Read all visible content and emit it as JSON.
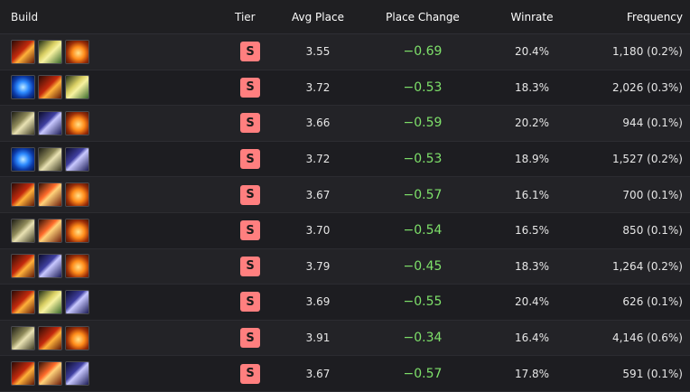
{
  "header": {
    "build": "Build",
    "tier": "Tier",
    "avg_place": "Avg Place",
    "place_change": "Place Change",
    "winrate": "Winrate",
    "frequency": "Frequency"
  },
  "rows": [
    {
      "items": [
        "blade-icon",
        "bolt-icon",
        "fire-orb-icon"
      ],
      "tier": "S",
      "avg_place": "3.55",
      "place_change": "−0.69",
      "winrate": "20.4%",
      "frequency": "1,180 (0.2%)"
    },
    {
      "items": [
        "water-orb-icon",
        "blade-icon",
        "bolt-icon"
      ],
      "tier": "S",
      "avg_place": "3.72",
      "place_change": "−0.53",
      "winrate": "18.3%",
      "frequency": "2,026 (0.3%)"
    },
    {
      "items": [
        "axe-icon",
        "spear-icon",
        "fire-orb-icon"
      ],
      "tier": "S",
      "avg_place": "3.66",
      "place_change": "−0.59",
      "winrate": "20.2%",
      "frequency": "944 (0.1%)"
    },
    {
      "items": [
        "water-orb-icon",
        "axe-icon",
        "spear-icon"
      ],
      "tier": "S",
      "avg_place": "3.72",
      "place_change": "−0.53",
      "winrate": "18.9%",
      "frequency": "1,527 (0.2%)"
    },
    {
      "items": [
        "blade-icon",
        "arrow-icon",
        "fire-orb-icon"
      ],
      "tier": "S",
      "avg_place": "3.67",
      "place_change": "−0.57",
      "winrate": "16.1%",
      "frequency": "700 (0.1%)"
    },
    {
      "items": [
        "axe-icon",
        "arrow-icon",
        "fire-orb-icon"
      ],
      "tier": "S",
      "avg_place": "3.70",
      "place_change": "−0.54",
      "winrate": "16.5%",
      "frequency": "850 (0.1%)"
    },
    {
      "items": [
        "blade-icon",
        "spear-icon",
        "fire-orb-icon"
      ],
      "tier": "S",
      "avg_place": "3.79",
      "place_change": "−0.45",
      "winrate": "18.3%",
      "frequency": "1,264 (0.2%)"
    },
    {
      "items": [
        "blade-icon",
        "bolt-icon",
        "spear-icon"
      ],
      "tier": "S",
      "avg_place": "3.69",
      "place_change": "−0.55",
      "winrate": "20.4%",
      "frequency": "626 (0.1%)"
    },
    {
      "items": [
        "axe-icon",
        "blade-icon",
        "fire-orb-icon"
      ],
      "tier": "S",
      "avg_place": "3.91",
      "place_change": "−0.34",
      "winrate": "16.4%",
      "frequency": "4,146 (0.6%)"
    },
    {
      "items": [
        "blade-icon",
        "arrow-icon",
        "spear-icon"
      ],
      "tier": "S",
      "avg_place": "3.67",
      "place_change": "−0.57",
      "winrate": "17.8%",
      "frequency": "591 (0.1%)"
    }
  ],
  "colors": {
    "tier_s": "#ff7f7f",
    "place_change_positive": "#7ee06a",
    "background": "#1b1b1e"
  }
}
